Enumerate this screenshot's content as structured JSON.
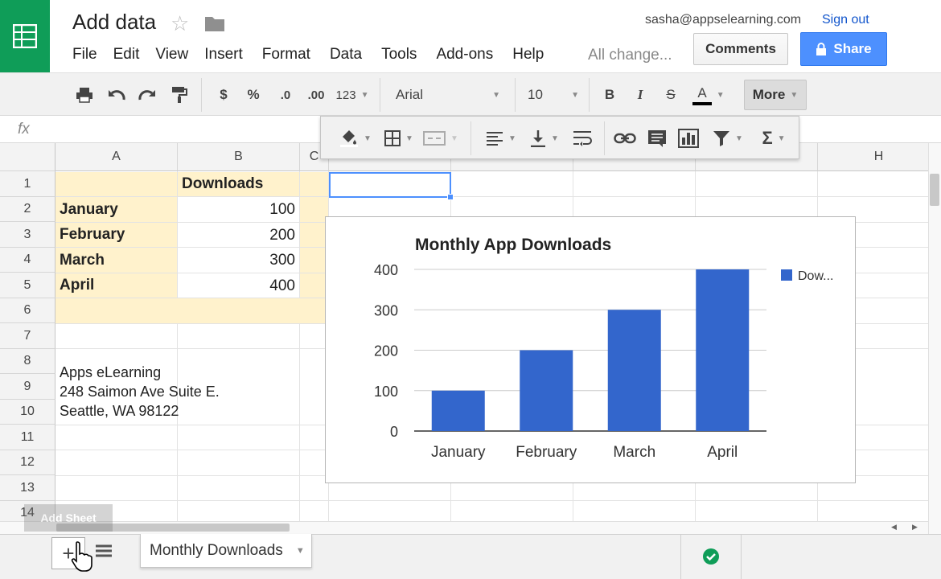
{
  "header": {
    "doc_title": "Add data",
    "user_email": "sasha@appselearning.com",
    "sign_out_label": "Sign out",
    "comments_label": "Comments",
    "share_label": "Share",
    "autosave_status": "All change...",
    "menu": [
      "File",
      "Edit",
      "View",
      "Insert",
      "Format",
      "Data",
      "Tools",
      "Add-ons",
      "Help"
    ]
  },
  "toolbar": {
    "currency_label": "$",
    "percent_label": "%",
    "decrease_decimal_label": ".0",
    "increase_decimal_label": ".00",
    "number_format_label": "123",
    "font_name": "Arial",
    "font_size": "10",
    "bold_label": "B",
    "italic_label": "I",
    "strike_label": "S",
    "text_color_label": "A",
    "more_label": "More",
    "popup_sum_label": "Σ"
  },
  "formula_bar": {
    "fx_label": "fx",
    "value": ""
  },
  "grid": {
    "columns": [
      "A",
      "B",
      "C",
      "",
      "",
      "",
      "",
      "H"
    ],
    "rows": [
      "1",
      "2",
      "3",
      "4",
      "5",
      "6",
      "7",
      "8",
      "9",
      "10",
      "11",
      "12",
      "13",
      "14"
    ],
    "header_cell": "Downloads",
    "months": [
      "January",
      "February",
      "March",
      "April"
    ],
    "values": [
      "100",
      "200",
      "300",
      "400"
    ],
    "address": [
      "Apps eLearning",
      "248 Saimon Ave Suite E.",
      "Seattle, WA 98122"
    ]
  },
  "chart_data": {
    "type": "bar",
    "title": "Monthly App Downloads",
    "categories": [
      "January",
      "February",
      "March",
      "April"
    ],
    "series": [
      {
        "name": "Dow...",
        "values": [
          100,
          200,
          300,
          400
        ],
        "color": "#3366cc"
      }
    ],
    "y_ticks": [
      "0",
      "100",
      "200",
      "300",
      "400"
    ],
    "ylim": [
      0,
      400
    ],
    "grid": true,
    "legend": "right"
  },
  "bottom": {
    "sheet_tab": "Monthly Downloads",
    "add_sheet_tooltip": "Add Sheet",
    "add_sheet_label": "+"
  },
  "colors": {
    "brand_green": "#0f9d58",
    "share_blue": "#4d90fe",
    "highlight_yellow": "#fff2cc",
    "bar_blue": "#3366cc"
  }
}
